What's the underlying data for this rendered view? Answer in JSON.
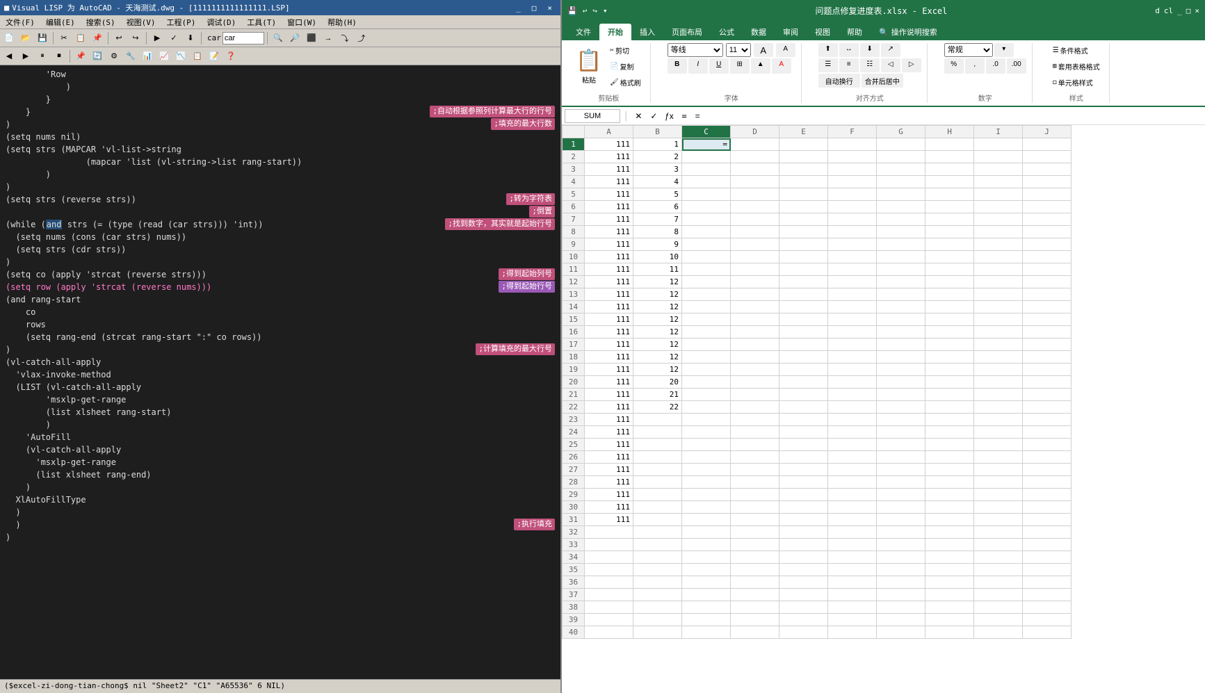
{
  "left": {
    "titlebar": "Visual LISP 为 AutoCAD - 天海测试.dwg - [1111111111111111.LSP]",
    "titlebar_icon": "■",
    "window_controls": [
      "_",
      "□",
      "×"
    ],
    "menubar": [
      "文件(F)",
      "编辑(E)",
      "搜索(S)",
      "视图(V)",
      "工程(P)",
      "调试(D)",
      "工具(T)",
      "窗口(W)",
      "帮助(H)"
    ],
    "search_label": "car",
    "statusbar": "($excel-zi-dong-tian-chong$  nil  \"Sheet2\"  \"C1\"  \"A65536\"  6  NIL)",
    "code_lines": [
      {
        "indent": 8,
        "text": "'Row",
        "color": "white"
      },
      {
        "indent": 12,
        "text": ")",
        "color": "white"
      },
      {
        "indent": 8,
        "text": "}",
        "color": "white"
      },
      {
        "indent": 4,
        "text": "}",
        "color": "white"
      },
      {
        "indent": 0,
        "text": ")",
        "color": "white"
      },
      {
        "indent": 0,
        "text": "(setq nums nil)",
        "color": "white"
      },
      {
        "indent": 0,
        "text": "(setq strs (MAPCAR 'vl-list->string",
        "color": "white"
      },
      {
        "indent": 16,
        "text": "(mapcar 'list (vl-string->list rang-start))",
        "color": "white"
      },
      {
        "indent": 8,
        "text": ")",
        "color": "white"
      },
      {
        "indent": 0,
        "text": ")",
        "color": "white"
      },
      {
        "indent": 0,
        "text": "(setq strs (reverse strs))",
        "color": "white",
        "annotation": ";转为字符表"
      },
      {
        "indent": 0,
        "text": "",
        "color": "white",
        "annotation2": ";倒置"
      },
      {
        "indent": 0,
        "text": "(while (and strs (= (type (read (car strs))) 'int))",
        "color": "white",
        "highlight_word": "and",
        "annotation": ";找到数字，其实就是起始行号"
      },
      {
        "indent": 2,
        "text": "(setq nums (cons (car strs) nums))",
        "color": "white"
      },
      {
        "indent": 2,
        "text": "(setq strs (cdr strs))",
        "color": "white"
      },
      {
        "indent": 0,
        "text": ")",
        "color": "white"
      },
      {
        "indent": 0,
        "text": "(setq co (apply 'strcat (reverse strs)))",
        "color": "white",
        "annotation": ";得到起始列号"
      },
      {
        "indent": 0,
        "text": "(setq row (apply 'strcat (reverse nums)))",
        "color": "white",
        "annotation_pink": ";得到起始行号"
      },
      {
        "indent": 0,
        "text": "(and rang-start",
        "color": "white"
      },
      {
        "indent": 4,
        "text": "co",
        "color": "white"
      },
      {
        "indent": 4,
        "text": "rows",
        "color": "white"
      },
      {
        "indent": 4,
        "text": "(setq rang-end (strcat rang-start \":\" co rows))",
        "color": "white"
      },
      {
        "indent": 0,
        "text": ")",
        "color": "white",
        "annotation": ";计算填充的最大行号"
      },
      {
        "indent": 0,
        "text": "(vl-catch-all-apply",
        "color": "white"
      },
      {
        "indent": 0,
        "text": "'vlax-invoke-method",
        "color": "white"
      },
      {
        "indent": 2,
        "text": "(LIST (vl-catch-all-apply",
        "color": "white"
      },
      {
        "indent": 8,
        "text": "'msxlp-get-range",
        "color": "white"
      },
      {
        "indent": 8,
        "text": "(list xlsheet rang-start)",
        "color": "white"
      },
      {
        "indent": 8,
        "text": ")",
        "color": "white"
      },
      {
        "indent": 4,
        "text": "'AutoFill",
        "color": "white"
      },
      {
        "indent": 4,
        "text": "(vl-catch-all-apply",
        "color": "white"
      },
      {
        "indent": 6,
        "text": "'msxlp-get-range",
        "color": "white"
      },
      {
        "indent": 6,
        "text": "(list xlsheet rang-end)",
        "color": "white"
      },
      {
        "indent": 4,
        "text": ")",
        "color": "white"
      },
      {
        "indent": 2,
        "text": "XlAutoFillType",
        "color": "white"
      },
      {
        "indent": 0,
        "text": ")",
        "color": "white"
      },
      {
        "indent": 0,
        "text": ")",
        "color": "white",
        "annotation": ";执行填充"
      },
      {
        "indent": 0,
        "text": ")",
        "color": "white"
      }
    ]
  },
  "right": {
    "titlebar": "问题点修复进度表.xlsx - Excel",
    "titlebar_controls": [
      "d",
      "cl",
      "×"
    ],
    "tabs": [
      "文件",
      "开始",
      "插入",
      "页面布局",
      "公式",
      "数据",
      "审阅",
      "视图",
      "帮助",
      "操作说明搜索"
    ],
    "active_tab": "开始",
    "ribbon_groups": [
      {
        "label": "剪贴板",
        "buttons": [
          "粘贴",
          "剪切",
          "复制",
          "格式刷"
        ]
      },
      {
        "label": "字体",
        "buttons": [
          "等线",
          "11",
          "B",
          "I",
          "U",
          "边框",
          "颜色",
          "字色"
        ]
      },
      {
        "label": "对齐方式",
        "buttons": [
          "左",
          "中",
          "右",
          "上",
          "中",
          "下",
          "换行",
          "合并"
        ]
      },
      {
        "label": "数字",
        "buttons": [
          "常规",
          "%",
          ",",
          ".0",
          ".00"
        ]
      },
      {
        "label": "样式",
        "buttons": [
          "条件格式",
          "套用表格格式",
          "单元格样式"
        ]
      }
    ],
    "formula_bar": {
      "name_box": "SUM",
      "formula": "="
    },
    "col_headers": [
      "",
      "A",
      "B",
      "C",
      "D",
      "E",
      "F",
      "G",
      "H",
      "I",
      "J"
    ],
    "rows": [
      {
        "num": 1,
        "a": "111",
        "b": "1",
        "c": "=",
        "d": "",
        "e": "",
        "f": "",
        "g": "",
        "h": "",
        "i": "",
        "j": ""
      },
      {
        "num": 2,
        "a": "111",
        "b": "2",
        "c": "",
        "d": "",
        "e": "",
        "f": "",
        "g": "",
        "h": "",
        "i": "",
        "j": ""
      },
      {
        "num": 3,
        "a": "111",
        "b": "3",
        "c": "",
        "d": "",
        "e": "",
        "f": "",
        "g": "",
        "h": "",
        "i": "",
        "j": ""
      },
      {
        "num": 4,
        "a": "111",
        "b": "4",
        "c": "",
        "d": "",
        "e": "",
        "f": "",
        "g": "",
        "h": "",
        "i": "",
        "j": ""
      },
      {
        "num": 5,
        "a": "111",
        "b": "5",
        "c": "",
        "d": "",
        "e": "",
        "f": "",
        "g": "",
        "h": "",
        "i": "",
        "j": ""
      },
      {
        "num": 6,
        "a": "111",
        "b": "6",
        "c": "",
        "d": "",
        "e": "",
        "f": "",
        "g": "",
        "h": "",
        "i": "",
        "j": ""
      },
      {
        "num": 7,
        "a": "111",
        "b": "7",
        "c": "",
        "d": "",
        "e": "",
        "f": "",
        "g": "",
        "h": "",
        "i": "",
        "j": ""
      },
      {
        "num": 8,
        "a": "111",
        "b": "8",
        "c": "",
        "d": "",
        "e": "",
        "f": "",
        "g": "",
        "h": "",
        "i": "",
        "j": ""
      },
      {
        "num": 9,
        "a": "111",
        "b": "9",
        "c": "",
        "d": "",
        "e": "",
        "f": "",
        "g": "",
        "h": "",
        "i": "",
        "j": ""
      },
      {
        "num": 10,
        "a": "111",
        "b": "10",
        "c": "",
        "d": "",
        "e": "",
        "f": "",
        "g": "",
        "h": "",
        "i": "",
        "j": ""
      },
      {
        "num": 11,
        "a": "111",
        "b": "11",
        "c": "",
        "d": "",
        "e": "",
        "f": "",
        "g": "",
        "h": "",
        "i": "",
        "j": ""
      },
      {
        "num": 12,
        "a": "111",
        "b": "12",
        "c": "",
        "d": "",
        "e": "",
        "f": "",
        "g": "",
        "h": "",
        "i": "",
        "j": ""
      },
      {
        "num": 13,
        "a": "111",
        "b": "12",
        "c": "",
        "d": "",
        "e": "",
        "f": "",
        "g": "",
        "h": "",
        "i": "",
        "j": ""
      },
      {
        "num": 14,
        "a": "111",
        "b": "12",
        "c": "",
        "d": "",
        "e": "",
        "f": "",
        "g": "",
        "h": "",
        "i": "",
        "j": ""
      },
      {
        "num": 15,
        "a": "111",
        "b": "12",
        "c": "",
        "d": "",
        "e": "",
        "f": "",
        "g": "",
        "h": "",
        "i": "",
        "j": ""
      },
      {
        "num": 16,
        "a": "111",
        "b": "12",
        "c": "",
        "d": "",
        "e": "",
        "f": "",
        "g": "",
        "h": "",
        "i": "",
        "j": ""
      },
      {
        "num": 17,
        "a": "111",
        "b": "12",
        "c": "",
        "d": "",
        "e": "",
        "f": "",
        "g": "",
        "h": "",
        "i": "",
        "j": ""
      },
      {
        "num": 18,
        "a": "111",
        "b": "12",
        "c": "",
        "d": "",
        "e": "",
        "f": "",
        "g": "",
        "h": "",
        "i": "",
        "j": ""
      },
      {
        "num": 19,
        "a": "111",
        "b": "12",
        "c": "",
        "d": "",
        "e": "",
        "f": "",
        "g": "",
        "h": "",
        "i": "",
        "j": ""
      },
      {
        "num": 20,
        "a": "111",
        "b": "20",
        "c": "",
        "d": "",
        "e": "",
        "f": "",
        "g": "",
        "h": "",
        "i": "",
        "j": ""
      },
      {
        "num": 21,
        "a": "111",
        "b": "21",
        "c": "",
        "d": "",
        "e": "",
        "f": "",
        "g": "",
        "h": "",
        "i": "",
        "j": ""
      },
      {
        "num": 22,
        "a": "111",
        "b": "22",
        "c": "",
        "d": "",
        "e": "",
        "f": "",
        "g": "",
        "h": "",
        "i": "",
        "j": ""
      },
      {
        "num": 23,
        "a": "111",
        "b": "",
        "c": "",
        "d": "",
        "e": "",
        "f": "",
        "g": "",
        "h": "",
        "i": "",
        "j": ""
      },
      {
        "num": 24,
        "a": "111",
        "b": "",
        "c": "",
        "d": "",
        "e": "",
        "f": "",
        "g": "",
        "h": "",
        "i": "",
        "j": ""
      },
      {
        "num": 25,
        "a": "111",
        "b": "",
        "c": "",
        "d": "",
        "e": "",
        "f": "",
        "g": "",
        "h": "",
        "i": "",
        "j": ""
      },
      {
        "num": 26,
        "a": "111",
        "b": "",
        "c": "",
        "d": "",
        "e": "",
        "f": "",
        "g": "",
        "h": "",
        "i": "",
        "j": ""
      },
      {
        "num": 27,
        "a": "111",
        "b": "",
        "c": "",
        "d": "",
        "e": "",
        "f": "",
        "g": "",
        "h": "",
        "i": "",
        "j": ""
      },
      {
        "num": 28,
        "a": "111",
        "b": "",
        "c": "",
        "d": "",
        "e": "",
        "f": "",
        "g": "",
        "h": "",
        "i": "",
        "j": ""
      },
      {
        "num": 29,
        "a": "111",
        "b": "",
        "c": "",
        "d": "",
        "e": "",
        "f": "",
        "g": "",
        "h": "",
        "i": "",
        "j": ""
      },
      {
        "num": 30,
        "a": "111",
        "b": "",
        "c": "",
        "d": "",
        "e": "",
        "f": "",
        "g": "",
        "h": "",
        "i": "",
        "j": ""
      },
      {
        "num": 31,
        "a": "111",
        "b": "",
        "c": "",
        "d": "",
        "e": "",
        "f": "",
        "g": "",
        "h": "",
        "i": "",
        "j": ""
      },
      {
        "num": 32,
        "a": "",
        "b": "",
        "c": "",
        "d": "",
        "e": "",
        "f": "",
        "g": "",
        "h": "",
        "i": "",
        "j": ""
      },
      {
        "num": 33,
        "a": "",
        "b": "",
        "c": "",
        "d": "",
        "e": "",
        "f": "",
        "g": "",
        "h": "",
        "i": "",
        "j": ""
      },
      {
        "num": 34,
        "a": "",
        "b": "",
        "c": "",
        "d": "",
        "e": "",
        "f": "",
        "g": "",
        "h": "",
        "i": "",
        "j": ""
      },
      {
        "num": 35,
        "a": "",
        "b": "",
        "c": "",
        "d": "",
        "e": "",
        "f": "",
        "g": "",
        "h": "",
        "i": "",
        "j": ""
      },
      {
        "num": 36,
        "a": "",
        "b": "",
        "c": "",
        "d": "",
        "e": "",
        "f": "",
        "g": "",
        "h": "",
        "i": "",
        "j": ""
      },
      {
        "num": 37,
        "a": "",
        "b": "",
        "c": "",
        "d": "",
        "e": "",
        "f": "",
        "g": "",
        "h": "",
        "i": "",
        "j": ""
      },
      {
        "num": 38,
        "a": "",
        "b": "",
        "c": "",
        "d": "",
        "e": "",
        "f": "",
        "g": "",
        "h": "",
        "i": "",
        "j": ""
      },
      {
        "num": 39,
        "a": "",
        "b": "",
        "c": "",
        "d": "",
        "e": "",
        "f": "",
        "g": "",
        "h": "",
        "i": "",
        "j": ""
      },
      {
        "num": 40,
        "a": "",
        "b": "",
        "c": "",
        "d": "",
        "e": "",
        "f": "",
        "g": "",
        "h": "",
        "i": "",
        "j": ""
      }
    ]
  }
}
